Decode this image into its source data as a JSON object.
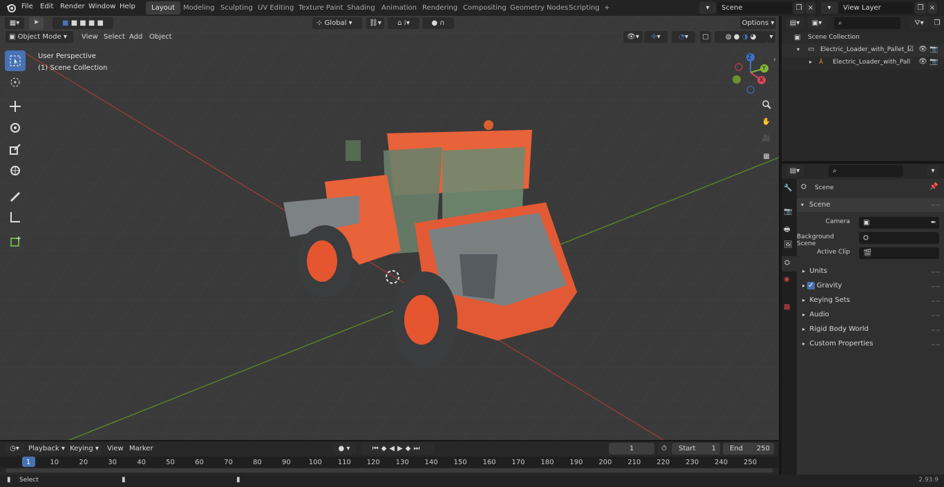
{
  "menu": {
    "file": "File",
    "edit": "Edit",
    "render": "Render",
    "window": "Window",
    "help": "Help"
  },
  "workspaces": [
    "Layout",
    "Modeling",
    "Sculpting",
    "UV Editing",
    "Texture Paint",
    "Shading",
    "Animation",
    "Rendering",
    "Compositing",
    "Geometry Nodes",
    "Scripting"
  ],
  "workspace_add": "+",
  "scene_name": "Scene",
  "view_layer": "View Layer",
  "header": {
    "transform_orientation": "Global",
    "options": "Options"
  },
  "viewport_header": {
    "mode": "Object Mode",
    "view": "View",
    "select": "Select",
    "add": "Add",
    "object": "Object"
  },
  "viewport_overlay": {
    "perspective": "User Perspective",
    "collection": "(1) Scene Collection"
  },
  "gizmo": {
    "x": "X",
    "y": "Y",
    "z": "Z"
  },
  "outliner": {
    "root": "Scene Collection",
    "items": [
      {
        "label": "Electric_Loader_with_Pallet_F"
      },
      {
        "label": "Electric_Loader_with_Pall"
      }
    ]
  },
  "properties": {
    "context": "Scene",
    "panel_title": "Scene",
    "camera_label": "Camera",
    "background_label": "Background Scene",
    "clip_label": "Active Clip",
    "sections": [
      "Units",
      "Gravity",
      "Keying Sets",
      "Audio",
      "Rigid Body World",
      "Custom Properties"
    ]
  },
  "timeline": {
    "playback": "Playback",
    "keying": "Keying",
    "view": "View",
    "marker": "Marker",
    "current_frame": "1",
    "start_label": "Start",
    "start": "1",
    "end_label": "End",
    "end": "250",
    "ticks": [
      "1",
      "10",
      "20",
      "30",
      "40",
      "50",
      "60",
      "70",
      "80",
      "90",
      "100",
      "110",
      "120",
      "130",
      "140",
      "150",
      "160",
      "170",
      "180",
      "190",
      "200",
      "210",
      "220",
      "230",
      "240",
      "250"
    ]
  },
  "status": {
    "select": "Select",
    "version": "2.93.9"
  },
  "colors": {
    "accent": "#4772b3",
    "loader_orange": "#e8623a",
    "axis_x": "#c33f3f",
    "axis_y": "#6e9c2c",
    "viewport_bg": "#3a3a3a"
  }
}
